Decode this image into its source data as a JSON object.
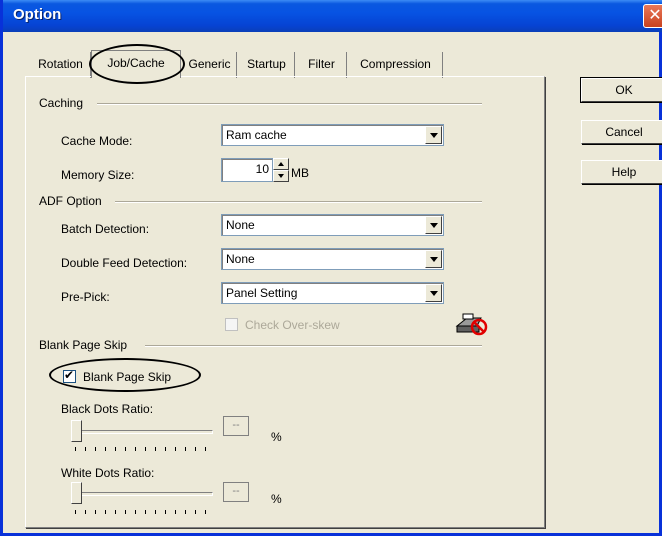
{
  "window": {
    "title": "Option",
    "close_glyph": "✕"
  },
  "tabs": [
    {
      "label": "Rotation"
    },
    {
      "label": "Job/Cache"
    },
    {
      "label": "Generic"
    },
    {
      "label": "Startup"
    },
    {
      "label": "Filter"
    },
    {
      "label": "Compression"
    }
  ],
  "active_tab": "Job/Cache",
  "caching": {
    "group_label": "Caching",
    "cache_mode_label": "Cache Mode:",
    "cache_mode_value": "Ram cache",
    "memory_size_label": "Memory Size:",
    "memory_size_value": "10",
    "memory_size_unit": "MB"
  },
  "adf": {
    "group_label": "ADF Option",
    "batch_detection_label": "Batch Detection:",
    "batch_detection_value": "None",
    "double_feed_label": "Double Feed Detection:",
    "double_feed_value": "None",
    "pre_pick_label": "Pre-Pick:",
    "pre_pick_value": "Panel Setting",
    "check_overskew_label": "Check Over-skew",
    "check_overskew_checked": false,
    "check_overskew_enabled": false
  },
  "blank_page_skip": {
    "group_label": "Blank Page Skip",
    "checkbox_label": "Blank Page Skip",
    "checked": true,
    "black_dots_label": "Black Dots Ratio:",
    "black_dots_value": "--",
    "black_dots_unit": "%",
    "white_dots_label": "White Dots Ratio:",
    "white_dots_value": "--",
    "white_dots_unit": "%"
  },
  "buttons": {
    "ok": "OK",
    "cancel": "Cancel",
    "help": "Help"
  },
  "icons": {
    "scanner": "scanner-no-icon",
    "close": "close-icon"
  },
  "colors": {
    "titlebar": "#0753e3",
    "dialog_bg": "#ece9d8",
    "close_btn": "#c9421f",
    "no_sign": "#e00000"
  }
}
